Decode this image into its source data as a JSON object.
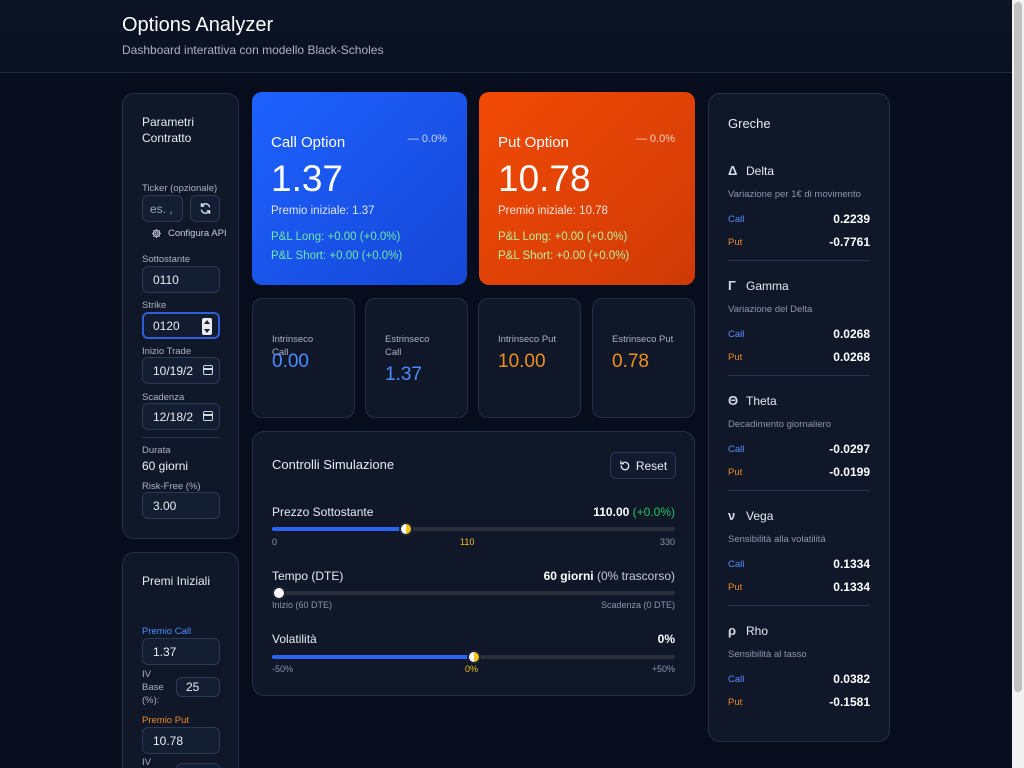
{
  "header": {
    "title": "Options Analyzer",
    "subtitle": "Dashboard interattiva con modello Black-Scholes"
  },
  "params": {
    "title": "Parametri Contratto",
    "ticker_label": "Ticker (opzionale)",
    "ticker_placeholder": "es. AAPL",
    "ticker_visible": "es. ,",
    "configura_api": "Configura API",
    "sottostante_label": "Sottostante",
    "sottostante_value": "0110",
    "strike_label": "Strike",
    "strike_value": "0120",
    "inizio_label": "Inizio Trade",
    "inizio_value": "10/19/2",
    "scadenza_label": "Scadenza",
    "scadenza_value": "12/18/2",
    "durata_label": "Durata",
    "durata_value": "60 giorni",
    "riskfree_label": "Risk-Free (%)",
    "riskfree_value": "3.00"
  },
  "premi": {
    "title": "Premi Iniziali",
    "call_label": "Premio Call",
    "call_value": "1.37",
    "iv_label_1": "IV",
    "iv_label_2": "Base",
    "iv_label_3": "(%):",
    "iv_value": "25",
    "put_label": "Premio Put",
    "put_value": "10.78",
    "iv_label_bottom": "IV"
  },
  "call_card": {
    "name": "Call Option",
    "change": "0.0%",
    "price": "1.37",
    "initial": "Premio iniziale: 1.37",
    "pl_long": "P&L Long: +0.00 (+0.0%)",
    "pl_short": "P&L Short: +0.00 (+0.0%)"
  },
  "put_card": {
    "name": "Put Option",
    "change": "0.0%",
    "price": "10.78",
    "initial": "Premio iniziale: 10.78",
    "pl_long": "P&L Long: +0.00 (+0.0%)",
    "pl_short": "P&L Short: +0.00 (+0.0%)"
  },
  "values": [
    {
      "label": "Intrinseco Call",
      "value": "0.00",
      "color": "#4d8dff"
    },
    {
      "label": "Estrinseco Call",
      "value": "1.37",
      "color": "#4d8dff"
    },
    {
      "label": "Intrinseco Put",
      "value": "10.00",
      "color": "#f0901e"
    },
    {
      "label": "Estrinseco Put",
      "value": "0.78",
      "color": "#f0901e"
    }
  ],
  "sim": {
    "title": "Controlli Simulazione",
    "reset": "Reset",
    "price_label": "Prezzo Sottostante",
    "price_value": "110.00",
    "price_change": "(+0.0%)",
    "price_min": "0",
    "price_mid": "110",
    "price_max": "330",
    "price_fraction": 0.3333,
    "time_label": "Tempo (DTE)",
    "time_value": "60 giorni",
    "time_extra": "(0% trascorso)",
    "time_min": "Inizio (60 DTE)",
    "time_max": "Scadenza (0 DTE)",
    "time_fraction": 0.0,
    "vol_label": "Volatilità",
    "vol_value": "0%",
    "vol_min": "-50%",
    "vol_mid": "0%",
    "vol_max": "+50%",
    "vol_fraction": 0.5
  },
  "greeks": {
    "title": "Greche",
    "call_label": "Call",
    "put_label": "Put",
    "items": [
      {
        "symbol": "Δ",
        "name": "Delta",
        "desc": "Variazione per 1€ di movimento",
        "call": "0.2239",
        "put": "-0.7761"
      },
      {
        "symbol": "Γ",
        "name": "Gamma",
        "desc": "Variazione del Delta",
        "call": "0.0268",
        "put": "0.0268"
      },
      {
        "symbol": "Θ",
        "name": "Theta",
        "desc": "Decadimento giornaliero",
        "call": "-0.0297",
        "put": "-0.0199"
      },
      {
        "symbol": "ν",
        "name": "Vega",
        "desc": "Sensibilità alla volatilità",
        "call": "0.1334",
        "put": "0.1334"
      },
      {
        "symbol": "ρ",
        "name": "Rho",
        "desc": "Sensibilità al tasso",
        "call": "0.0382",
        "put": "-0.1581"
      }
    ]
  },
  "colors": {
    "call": "#1d62ff",
    "put": "#f24a05",
    "positive": "#22c55e",
    "accent_yellow": "#f5c518"
  }
}
